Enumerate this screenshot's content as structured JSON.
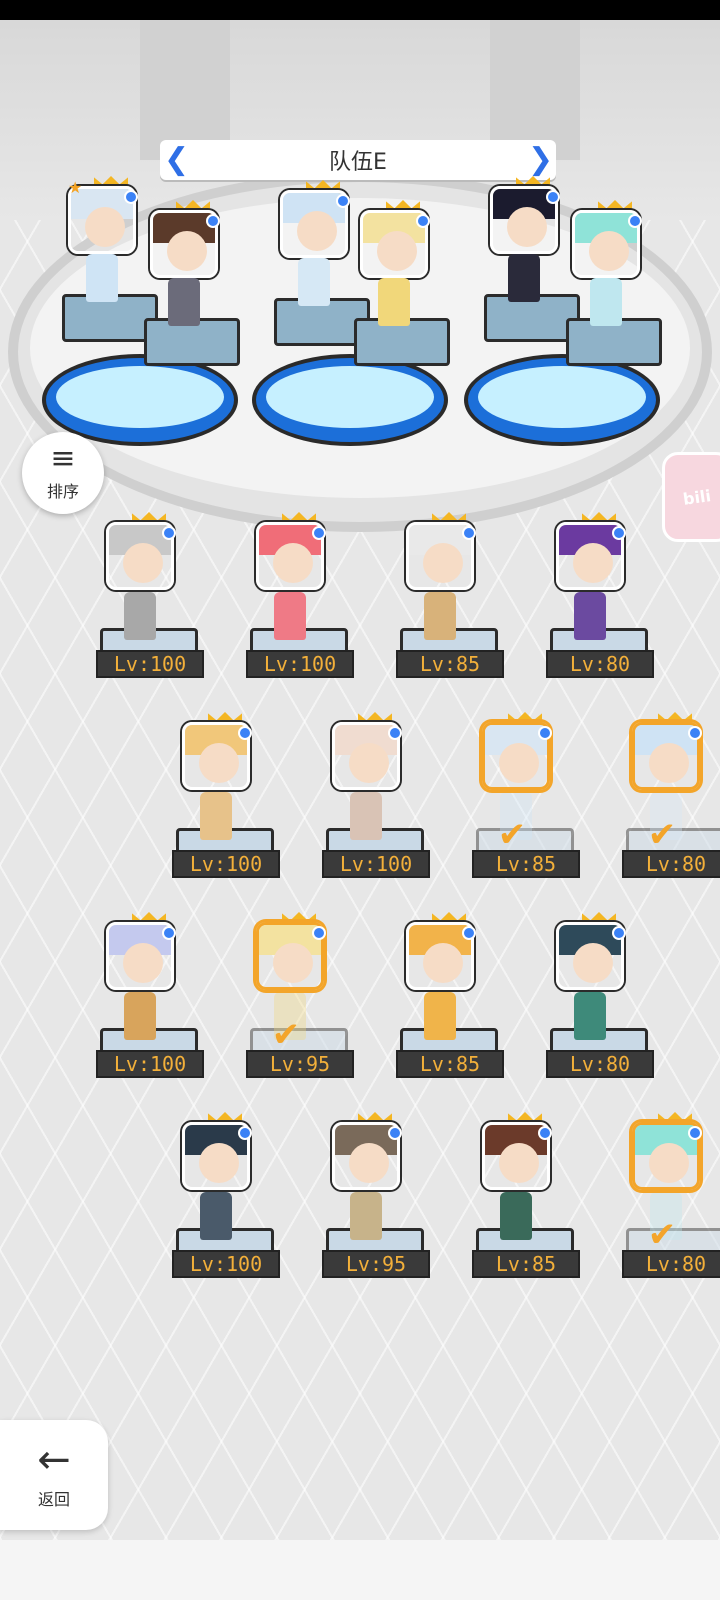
{
  "team": {
    "title": "队伍E",
    "prev_arrow": "❮",
    "next_arrow": "❯"
  },
  "sort_button": {
    "label": "排序",
    "icon": "sort-icon"
  },
  "bili_badge": {
    "text": "bili"
  },
  "back_button": {
    "label": "返回",
    "icon": "arrow-left-icon"
  },
  "team_members": [
    {
      "hair": "#d9e6f2",
      "sprite": "#cfe4f5",
      "star": true
    },
    {
      "hair": "#5b3a2a",
      "sprite": "#6b6b7a"
    },
    {
      "hair": "#cfe3f4",
      "sprite": "#d6e8f5"
    },
    {
      "hair": "#f3e2a0",
      "sprite": "#f1d77a"
    },
    {
      "hair": "#1b1b2e",
      "sprite": "#2a2a3a"
    },
    {
      "hair": "#8fe3d8",
      "sprite": "#bfe7ef"
    }
  ],
  "roster": [
    {
      "level": "Lv:100",
      "hair": "#c8c8c8",
      "sprite": "#a8a8a8",
      "selected": false
    },
    {
      "level": "Lv:100",
      "hair": "#f06d78",
      "sprite": "#ef7a86",
      "selected": false
    },
    {
      "level": "Lv:85",
      "hair": "#e9e9e9",
      "sprite": "#d8b27a",
      "selected": false
    },
    {
      "level": "Lv:80",
      "hair": "#6b3aa0",
      "sprite": "#6b4aa0",
      "selected": false
    },
    {
      "level": "Lv:100",
      "hair": "#f1c77a",
      "sprite": "#e7c28a",
      "selected": false
    },
    {
      "level": "Lv:100",
      "hair": "#f0dcd0",
      "sprite": "#d9c3b5",
      "selected": false
    },
    {
      "level": "Lv:85",
      "hair": "#d9e6f2",
      "sprite": "#cfe4f5",
      "selected": true
    },
    {
      "level": "Lv:80",
      "hair": "#cfe3f4",
      "sprite": "#d6e8f5",
      "selected": true
    },
    {
      "level": "Lv:100",
      "hair": "#c4c9ee",
      "sprite": "#d8a45c",
      "selected": false
    },
    {
      "level": "Lv:95",
      "hair": "#f3e2a0",
      "sprite": "#f1d77a",
      "selected": true
    },
    {
      "level": "Lv:85",
      "hair": "#f2b34a",
      "sprite": "#f0b44a",
      "selected": false
    },
    {
      "level": "Lv:80",
      "hair": "#2e4a5a",
      "sprite": "#3e8a7a",
      "selected": false
    },
    {
      "level": "Lv:100",
      "hair": "#2a3a4a",
      "sprite": "#4a5a6a",
      "selected": false
    },
    {
      "level": "Lv:95",
      "hair": "#7a6a5a",
      "sprite": "#c7b38a",
      "selected": false
    },
    {
      "level": "Lv:85",
      "hair": "#6b3a2a",
      "sprite": "#3a6a5a",
      "selected": false
    },
    {
      "level": "Lv:80",
      "hair": "#8fe3d8",
      "sprite": "#bfe7ef",
      "selected": true
    }
  ],
  "check_mark": "✔"
}
